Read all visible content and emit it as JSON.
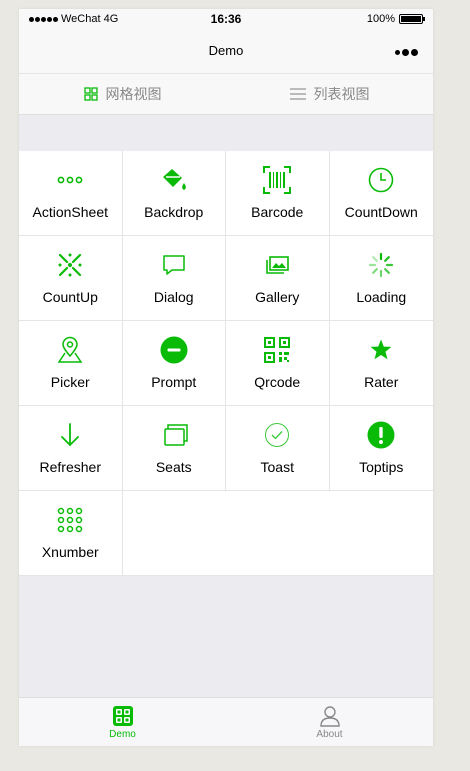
{
  "status_bar": {
    "carrier": "WeChat 4G",
    "time": "16:36",
    "battery": "100%"
  },
  "nav": {
    "title": "Demo",
    "more_icon": "more-dots-icon"
  },
  "view_tabs": [
    {
      "label": "网格视图",
      "icon": "grid-icon"
    },
    {
      "label": "列表视图",
      "icon": "list-icon"
    }
  ],
  "components": [
    {
      "label": "ActionSheet",
      "icon": "dots-icon"
    },
    {
      "label": "Backdrop",
      "icon": "paint-bucket-icon"
    },
    {
      "label": "Barcode",
      "icon": "barcode-scan-icon"
    },
    {
      "label": "CountDown",
      "icon": "clock-icon"
    },
    {
      "label": "CountUp",
      "icon": "sparkle-icon"
    },
    {
      "label": "Dialog",
      "icon": "chat-bubble-icon"
    },
    {
      "label": "Gallery",
      "icon": "photo-stack-icon"
    },
    {
      "label": "Loading",
      "icon": "spinner-icon"
    },
    {
      "label": "Picker",
      "icon": "map-pin-icon"
    },
    {
      "label": "Prompt",
      "icon": "minus-circle-icon"
    },
    {
      "label": "Qrcode",
      "icon": "qrcode-icon"
    },
    {
      "label": "Rater",
      "icon": "star-icon"
    },
    {
      "label": "Refresher",
      "icon": "arrow-down-icon"
    },
    {
      "label": "Seats",
      "icon": "cards-icon"
    },
    {
      "label": "Toast",
      "icon": "check-circle-icon"
    },
    {
      "label": "Toptips",
      "icon": "exclamation-circle-icon"
    },
    {
      "label": "Xnumber",
      "icon": "dot-grid-icon"
    }
  ],
  "tab_bar": [
    {
      "label": "Demo",
      "icon": "demo-tab-icon",
      "active": true
    },
    {
      "label": "About",
      "icon": "person-icon",
      "active": false
    }
  ],
  "colors": {
    "accent": "#09bb07",
    "inactive": "#888888"
  }
}
